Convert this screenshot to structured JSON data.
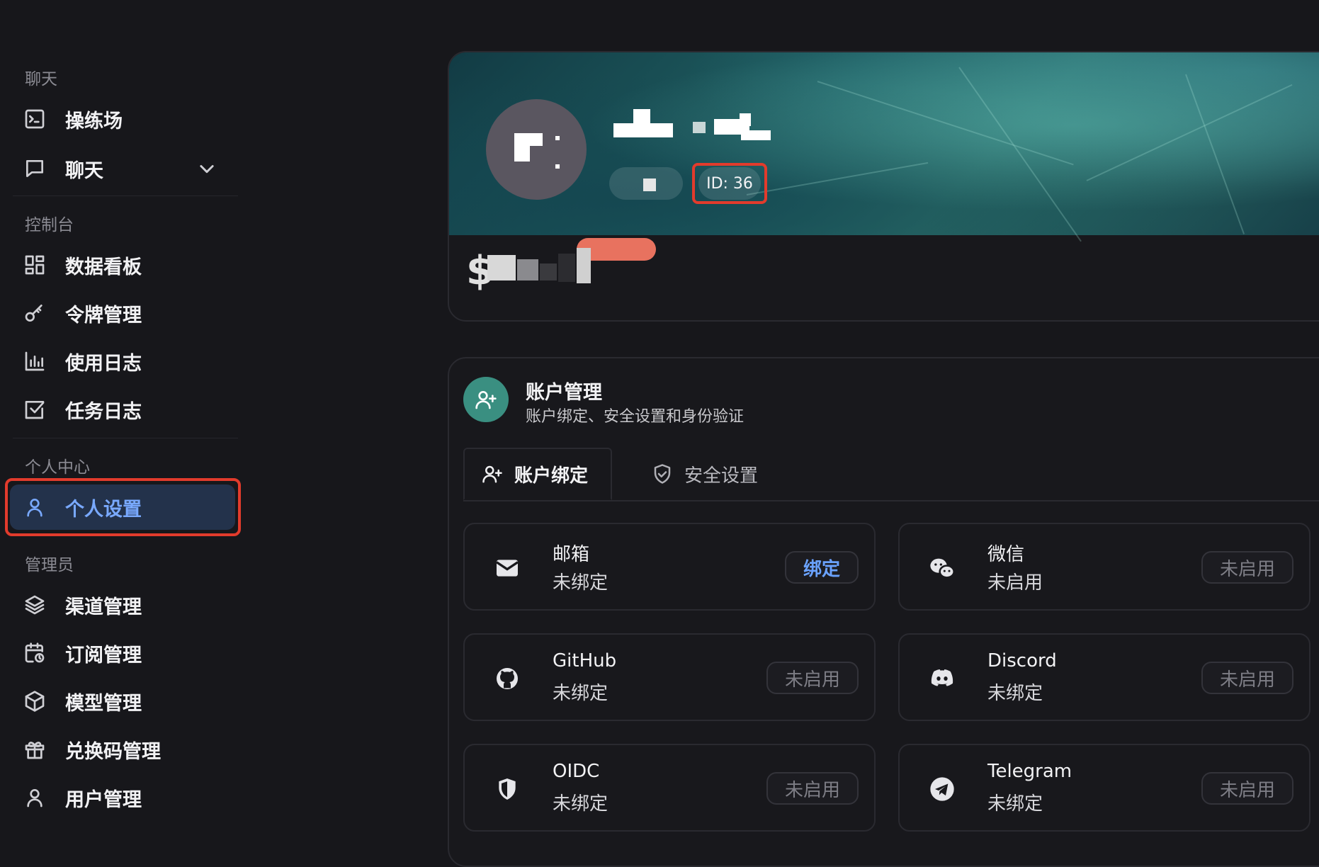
{
  "sidebar": {
    "sections": [
      {
        "title": "聊天"
      },
      {
        "title": "控制台"
      },
      {
        "title": "个人中心"
      },
      {
        "title": "管理员"
      }
    ],
    "items": [
      {
        "label": "操练场",
        "icon": "terminal-icon"
      },
      {
        "label": "聊天",
        "icon": "chat-bubble-icon"
      },
      {
        "label": "数据看板",
        "icon": "dashboard-grid-icon"
      },
      {
        "label": "令牌管理",
        "icon": "key-icon"
      },
      {
        "label": "使用日志",
        "icon": "bar-chart-icon"
      },
      {
        "label": "任务日志",
        "icon": "checkbox-icon"
      },
      {
        "label": "个人设置",
        "icon": "user-icon",
        "active": true
      },
      {
        "label": "渠道管理",
        "icon": "layers-icon"
      },
      {
        "label": "订阅管理",
        "icon": "calendar-clock-icon"
      },
      {
        "label": "模型管理",
        "icon": "cube-icon"
      },
      {
        "label": "兑换码管理",
        "icon": "gift-icon"
      },
      {
        "label": "用户管理",
        "icon": "user-icon"
      }
    ]
  },
  "profile": {
    "id_label": "ID: 36"
  },
  "account": {
    "title": "账户管理",
    "subtitle": "账户绑定、安全设置和身份验证",
    "tabs": [
      {
        "label": "账户绑定",
        "active": true
      },
      {
        "label": "安全设置",
        "active": false
      }
    ],
    "bindings": [
      {
        "name": "邮箱",
        "status": "未绑定",
        "button": "绑定",
        "icon": "mail-icon"
      },
      {
        "name": "微信",
        "status": "未启用",
        "button": "未启用",
        "icon": "wechat-icon"
      },
      {
        "name": "GitHub",
        "status": "未绑定",
        "button": "未启用",
        "icon": "github-icon"
      },
      {
        "name": "Discord",
        "status": "未绑定",
        "button": "未启用",
        "icon": "discord-icon"
      },
      {
        "name": "OIDC",
        "status": "未绑定",
        "button": "未启用",
        "icon": "shield-icon"
      },
      {
        "name": "Telegram",
        "status": "未绑定",
        "button": "未启用",
        "icon": "telegram-icon"
      }
    ]
  },
  "colors": {
    "background": "#17171b",
    "accent_blue": "#6aa2ff",
    "highlight_red": "#e23b2c",
    "acct_icon_green": "#3a8f81"
  }
}
